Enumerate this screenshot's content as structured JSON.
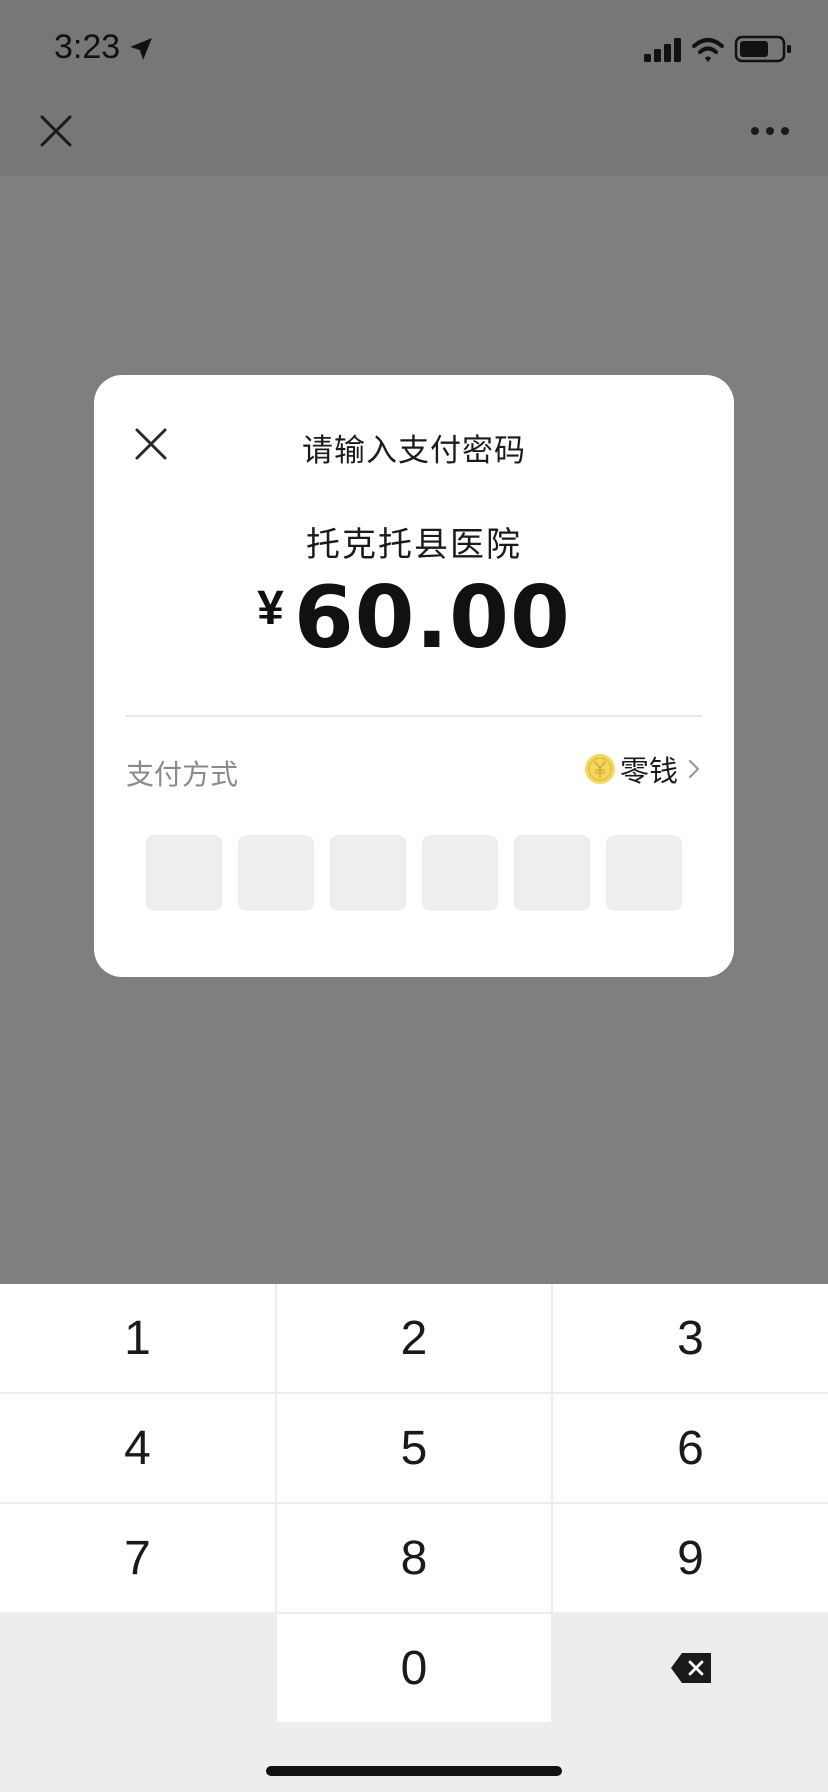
{
  "status_bar": {
    "time": "3:23",
    "icons": [
      "location-arrow-icon",
      "signal-bars-icon",
      "wifi-icon",
      "battery-icon"
    ]
  },
  "nav": {
    "close_icon": "close-icon",
    "more_icon": "more-icon"
  },
  "dialog": {
    "title": "请输入支付密码",
    "merchant": "托克托县医院",
    "currency_symbol": "¥",
    "amount": "60.00",
    "payment_method_label": "支付方式",
    "payment_method_value": "零钱",
    "pin_length": 6
  },
  "keypad": {
    "keys": [
      "1",
      "2",
      "3",
      "4",
      "5",
      "6",
      "7",
      "8",
      "9",
      "",
      "0",
      "backspace"
    ]
  },
  "colors": {
    "overlay": "#7f7f7f",
    "topbar": "#777777",
    "coin": "#f3d75f",
    "pin_box": "#eeeeee",
    "keypad_bg": "#ededed"
  }
}
